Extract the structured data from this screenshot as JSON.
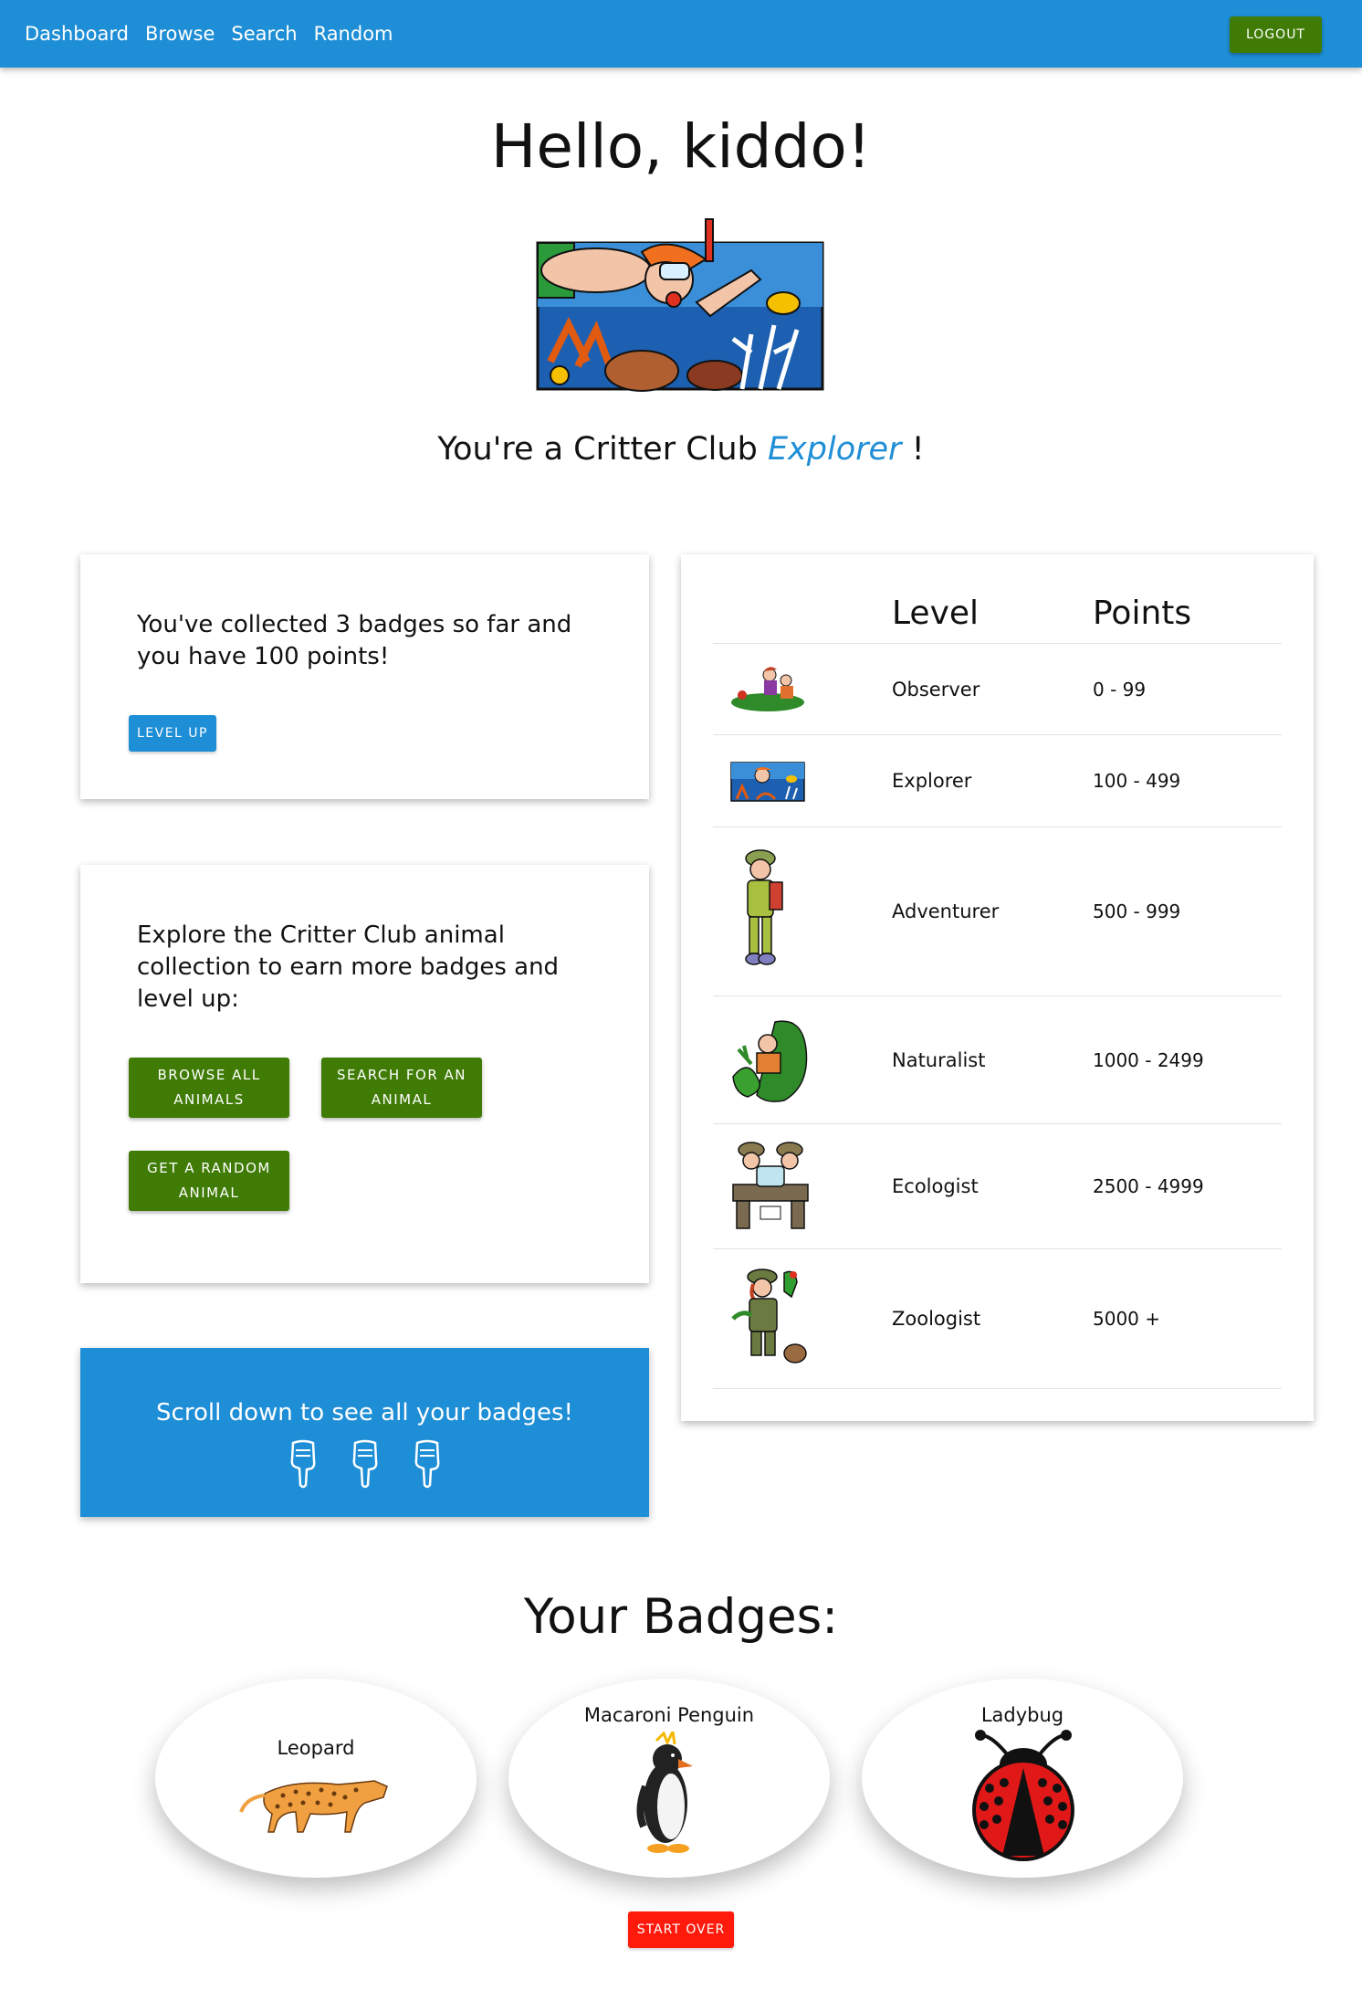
{
  "nav": {
    "links": [
      "Dashboard",
      "Browse",
      "Search",
      "Random"
    ],
    "logout_label": "LOGOUT"
  },
  "hero": {
    "greeting": "Hello, kiddo!",
    "rank_prefix": "You're a Critter Club",
    "rank": "Explorer",
    "rank_suffix": "!"
  },
  "status_card": {
    "text": "You've collected 3 badges so far and you have 100 points!",
    "level_up_label": "LEVEL UP"
  },
  "explore_card": {
    "text": "Explore the Critter Club animal collection to earn more badges and level up:",
    "buttons": [
      "BROWSE ALL ANIMALS",
      "SEARCH FOR AN ANIMAL",
      "GET A RANDOM ANIMAL"
    ]
  },
  "scroll_card": {
    "text": "Scroll down to see all your badges!",
    "icons": [
      "pointing-down-hand-icon",
      "pointing-down-hand-icon",
      "pointing-down-hand-icon"
    ]
  },
  "levels": {
    "headers": [
      "Level",
      "Points"
    ],
    "rows": [
      {
        "name": "Observer",
        "points": "0 - 99",
        "icon": "observer-kids-icon"
      },
      {
        "name": "Explorer",
        "points": "100 - 499",
        "icon": "snorkeler-icon"
      },
      {
        "name": "Adventurer",
        "points": "500 - 999",
        "icon": "hiker-icon"
      },
      {
        "name": "Naturalist",
        "points": "1000 - 2499",
        "icon": "naturalist-icon"
      },
      {
        "name": "Ecologist",
        "points": "2500 - 4999",
        "icon": "ecologist-lab-icon"
      },
      {
        "name": "Zoologist",
        "points": "5000 +",
        "icon": "zoologist-icon"
      }
    ]
  },
  "badges": {
    "title": "Your Badges:",
    "items": [
      {
        "name": "Leopard",
        "icon": "leopard-icon"
      },
      {
        "name": "Macaroni Penguin",
        "icon": "penguin-icon"
      },
      {
        "name": "Ladybug",
        "icon": "ladybug-icon"
      }
    ],
    "start_over_label": "START OVER"
  },
  "colors": {
    "primary": "#1e8ed6",
    "green": "#3f7b05",
    "red": "#ff1a0b"
  }
}
